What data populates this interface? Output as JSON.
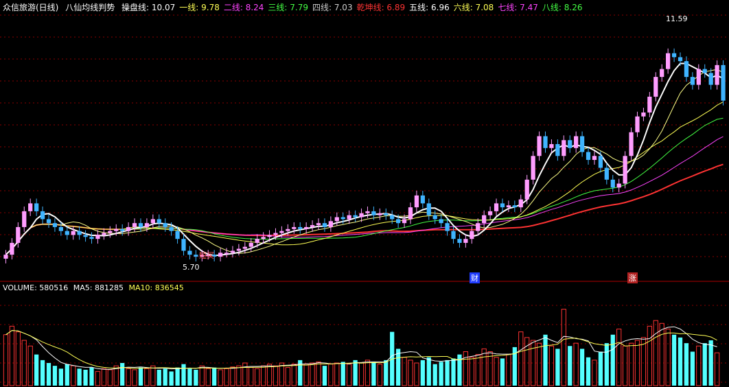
{
  "header": {
    "title": "众信旅游(日线)",
    "indicator_name": "八仙均线判势",
    "lines": [
      {
        "label": "操盘线:",
        "value": "10.07",
        "color": "#ffffff"
      },
      {
        "label": "一线:",
        "value": "9.78",
        "color": "#ffff55"
      },
      {
        "label": "二线:",
        "value": "8.24",
        "color": "#ff44ff"
      },
      {
        "label": "三线:",
        "value": "7.79",
        "color": "#44ff44"
      },
      {
        "label": "四线:",
        "value": "7.03",
        "color": "#cccccc"
      },
      {
        "label": "乾坤线:",
        "value": "6.89",
        "color": "#ff3333"
      },
      {
        "label": "五线:",
        "value": "6.96",
        "color": "#ffffff"
      },
      {
        "label": "六线:",
        "value": "7.08",
        "color": "#ffff55"
      },
      {
        "label": "七线:",
        "value": "7.47",
        "color": "#ff44ff"
      },
      {
        "label": "八线:",
        "value": "8.26",
        "color": "#44ff44"
      }
    ]
  },
  "volume_header": {
    "label": "VOLUME: 580516",
    "ma5": "MA5: 881285",
    "ma10": "MA10: 836545"
  },
  "annotations": {
    "high": "11.59",
    "low": "5.70",
    "buy_signal": "短买",
    "tag_cai": "财",
    "tag_zhang": "涨"
  },
  "colors": {
    "up": "#ff3333",
    "down": "#54ffff",
    "pink": "#ff9dff",
    "cyan_bar": "#3fb4ff",
    "grid": "#8b0000"
  },
  "chart_data": {
    "type": "candlestick",
    "ylim": [
      5.4,
      12.0
    ],
    "closes": [
      5.9,
      6.2,
      6.6,
      7.0,
      7.2,
      7.0,
      6.8,
      6.7,
      6.6,
      6.5,
      6.4,
      6.5,
      6.4,
      6.35,
      6.3,
      6.4,
      6.45,
      6.5,
      6.55,
      6.5,
      6.6,
      6.7,
      6.6,
      6.7,
      6.8,
      6.7,
      6.6,
      6.5,
      6.3,
      6.0,
      5.9,
      5.85,
      5.9,
      5.9,
      5.85,
      5.95,
      5.95,
      6.0,
      6.05,
      6.1,
      6.2,
      6.3,
      6.35,
      6.4,
      6.45,
      6.5,
      6.55,
      6.6,
      6.55,
      6.6,
      6.65,
      6.7,
      6.6,
      6.75,
      6.85,
      6.8,
      6.9,
      6.85,
      6.95,
      7.0,
      6.9,
      6.95,
      6.9,
      6.8,
      6.7,
      6.8,
      7.1,
      7.4,
      7.2,
      6.9,
      6.8,
      6.7,
      6.5,
      6.3,
      6.2,
      6.3,
      6.5,
      6.7,
      6.9,
      7.0,
      7.2,
      7.1,
      7.15,
      7.1,
      7.3,
      7.8,
      8.4,
      8.9,
      8.6,
      8.7,
      8.4,
      8.8,
      8.6,
      8.9,
      8.5,
      8.3,
      8.4,
      8.1,
      7.8,
      7.6,
      7.7,
      8.4,
      9.0,
      9.4,
      9.5,
      9.9,
      10.4,
      10.6,
      11.0,
      10.9,
      10.8,
      10.4,
      10.2,
      10.6,
      10.5,
      10.2,
      10.7,
      9.8
    ],
    "volume_ylim": [
      0,
      1.6
    ],
    "volumes": [
      0.9,
      1.05,
      0.95,
      0.8,
      0.7,
      0.55,
      0.45,
      0.4,
      0.35,
      0.3,
      0.38,
      0.35,
      0.3,
      0.28,
      0.32,
      0.25,
      0.3,
      0.28,
      0.35,
      0.4,
      0.3,
      0.28,
      0.32,
      0.3,
      0.35,
      0.28,
      0.3,
      0.25,
      0.32,
      0.38,
      0.3,
      0.28,
      0.35,
      0.3,
      0.32,
      0.28,
      0.3,
      0.33,
      0.35,
      0.4,
      0.32,
      0.3,
      0.35,
      0.38,
      0.35,
      0.4,
      0.32,
      0.38,
      0.45,
      0.38,
      0.4,
      0.42,
      0.35,
      0.38,
      0.4,
      0.42,
      0.38,
      0.45,
      0.4,
      0.45,
      0.42,
      0.38,
      0.45,
      0.95,
      0.65,
      0.5,
      0.45,
      0.4,
      0.45,
      0.5,
      0.38,
      0.42,
      0.45,
      0.48,
      0.55,
      0.6,
      0.5,
      0.55,
      0.65,
      0.6,
      0.5,
      0.48,
      0.55,
      0.68,
      0.95,
      0.85,
      0.8,
      0.75,
      0.9,
      0.7,
      0.65,
      1.35,
      0.7,
      0.75,
      0.65,
      0.5,
      0.45,
      0.6,
      0.75,
      0.9,
      1.0,
      0.7,
      0.75,
      0.8,
      0.85,
      1.05,
      1.15,
      1.1,
      1.0,
      0.9,
      0.85,
      0.75,
      0.6,
      0.7,
      0.75,
      0.8,
      0.58
    ]
  }
}
